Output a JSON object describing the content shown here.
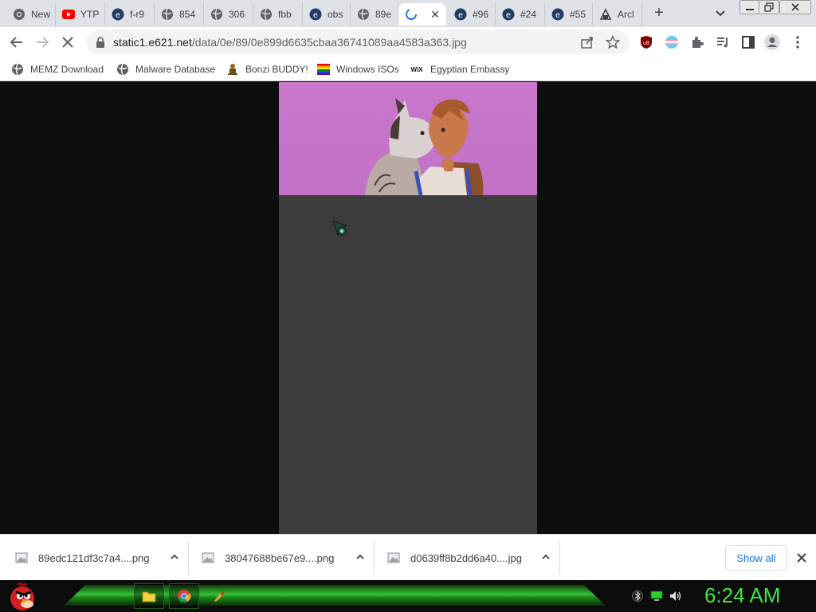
{
  "browser": {
    "tabs": [
      {
        "title": "New",
        "favicon": "chrome-icon"
      },
      {
        "title": "YTP",
        "favicon": "youtube-icon"
      },
      {
        "title": "f-r9",
        "favicon": "e621-icon"
      },
      {
        "title": "854",
        "favicon": "globe-icon"
      },
      {
        "title": "306",
        "favicon": "globe-icon"
      },
      {
        "title": "fbb",
        "favicon": "globe-icon"
      },
      {
        "title": "obs",
        "favicon": "e621-icon"
      },
      {
        "title": "89e",
        "favicon": "globe-icon"
      },
      {
        "title": "",
        "favicon": "loading-spinner-icon",
        "active": true
      },
      {
        "title": "#96",
        "favicon": "e621-icon"
      },
      {
        "title": "#24",
        "favicon": "e621-icon"
      },
      {
        "title": "#55",
        "favicon": "e621-icon"
      },
      {
        "title": "Arcl",
        "favicon": "archive-icon"
      }
    ],
    "tab_close_glyph": "✕",
    "new_tab_glyph": "+"
  },
  "toolbar": {
    "url_host": "static1.e621.net",
    "url_path": "/data/0e/89/0e899d6635cbaa36741089aa4583a363.jpg"
  },
  "bookmarks": [
    {
      "label": "MEMZ Download",
      "icon": "globe-icon"
    },
    {
      "label": "Malware Database",
      "icon": "globe-icon"
    },
    {
      "label": "Bonzi BUDDY!",
      "icon": "bonzi-icon"
    },
    {
      "label": "Windows ISOs",
      "icon": "rainbow-flag-icon"
    },
    {
      "label": "Egyptian Embassy",
      "icon": "wix-icon",
      "icon_text": "WiX"
    }
  ],
  "downloads": [
    {
      "filename": "89edc121df3c7a4....png"
    },
    {
      "filename": "38047688be67e9....png"
    },
    {
      "filename": "d0639ff8b2dd6a40....jpg"
    }
  ],
  "shelf": {
    "show_all_label": "Show all"
  },
  "taskbar": {
    "clock": "6:24 AM"
  },
  "colors": {
    "tab_strip": "#dee1e6",
    "art_background": "#c977cc",
    "viewer_background": "#3c3c3c",
    "clock_green": "#3fe73f",
    "link_blue": "#1a73e8"
  }
}
